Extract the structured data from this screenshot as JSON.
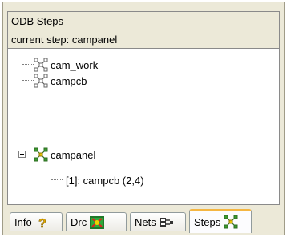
{
  "panel": {
    "title": "ODB Steps",
    "current_step_text": "current step: campanel"
  },
  "tree": {
    "items": [
      {
        "label": "cam_work",
        "icon": "step-icon"
      },
      {
        "label": "campcb",
        "icon": "step-icon"
      },
      {
        "label": "campanel",
        "icon": "step-icon-highlighted",
        "expanded": true
      },
      {
        "label": "[1]: campcb (2,4)",
        "icon": "none"
      }
    ]
  },
  "tabs": [
    {
      "label": "Info",
      "icon": "question-icon"
    },
    {
      "label": "Drc",
      "icon": "drc-icon"
    },
    {
      "label": "Nets",
      "icon": "nets-icon"
    },
    {
      "label": "Steps",
      "icon": "steps-icon",
      "active": true
    }
  ],
  "colors": {
    "panel_bg": "#ece9d8",
    "tree_bg": "#ffffff",
    "active_tab_accent": "#f5b642",
    "step_icon_green": "#3c9a2e",
    "step_icon_yellow": "#e8c400"
  }
}
